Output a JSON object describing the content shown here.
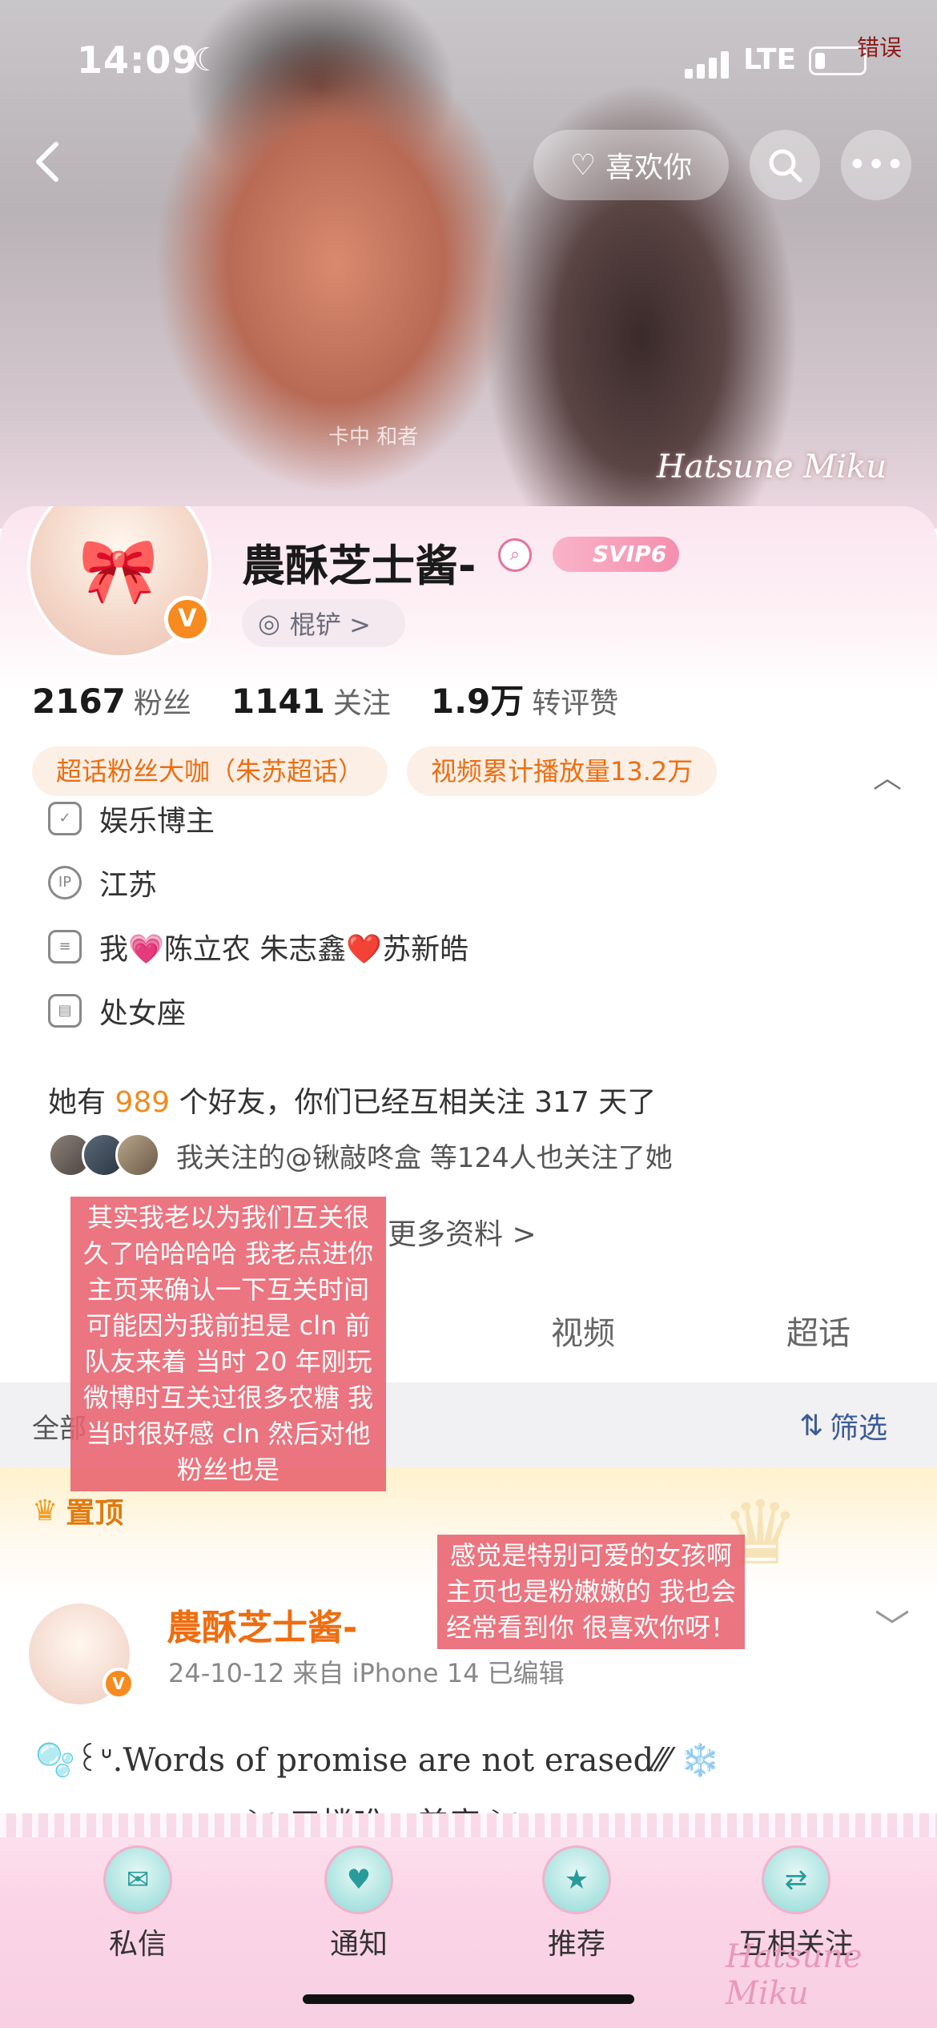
{
  "status_bar": {
    "time": "14:09",
    "network": "LTE",
    "watermark": "错误"
  },
  "cover": {
    "caption": "卡中 和者",
    "signature": "Hatsune Miku"
  },
  "nav": {
    "back_icon": "chevron-left-icon",
    "like_label": "喜欢你",
    "search_icon": "search-icon",
    "more_icon": "more-icon"
  },
  "profile": {
    "name": "農酥芝士酱-",
    "svip_label": "SVIP6",
    "verified": "V",
    "level_label": "棍铲 >",
    "stats": [
      {
        "value": "2167",
        "label": "粉丝"
      },
      {
        "value": "1141",
        "label": "关注"
      },
      {
        "value": "1.9万",
        "label": "转评赞"
      }
    ],
    "tags": [
      "超话粉丝大咖（朱苏超话）",
      "视频累计播放量13.2万"
    ],
    "info": [
      {
        "icon": "shield-icon",
        "text": "娱乐博主"
      },
      {
        "icon": "ip-icon",
        "text": "江苏"
      },
      {
        "icon": "document-icon",
        "text": "我💗陈立农 朱志鑫❤️苏新皓"
      },
      {
        "icon": "calendar-icon",
        "text": "处女座"
      }
    ],
    "friends_prefix": "她有",
    "friends_count": "989",
    "friends_suffix": "个好友，你们已经互相关注 317 天了",
    "mutual_text": "我关注的@锹敲咚盒  等124人也关注了她",
    "more_info": "更多资料 >"
  },
  "tabs": [
    "视频",
    "超话"
  ],
  "filter": {
    "all_label": "全部",
    "filter_label": "筛选"
  },
  "pinned": {
    "label": "置顶"
  },
  "post": {
    "author": "農酥芝士酱-",
    "meta": "24-10-12  来自 iPhone 14  已编辑",
    "text_line1": "🫧꒰ᐡ.Words of promise are not erased⁄⁄⁄  ❄️",
    "text_line2": "༄ 三楼唯一美帝 ༄"
  },
  "notes": {
    "note1": "其实我老以为我们互关很久了哈哈哈哈 我老点进你主页来确认一下互关时间 可能因为我前担是 cln 前队友来着 当时 20 年刚玩微博时互关过很多农糖 我当时很好感 cln 然后对他粉丝也是",
    "note2": "感觉是特别可爱的女孩啊 主页也是粉嫩嫩的 我也会经常看到你 很喜欢你呀！"
  },
  "bottom_nav": [
    {
      "label": "私信",
      "icon": "message-icon"
    },
    {
      "label": "通知",
      "icon": "bell-icon"
    },
    {
      "label": "推荐",
      "icon": "star-icon"
    },
    {
      "label": "互相关注",
      "icon": "mutual-icon"
    }
  ],
  "bottom_signature": "Hatsune Miku"
}
